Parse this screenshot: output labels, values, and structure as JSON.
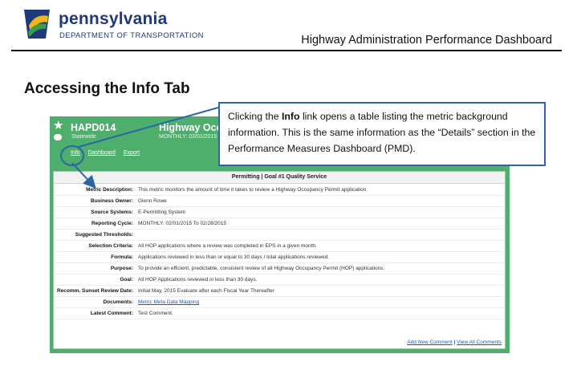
{
  "header": {
    "org_name": "pennsylvania",
    "org_dept": "DEPARTMENT OF TRANSPORTATION",
    "doc_title": "Highway Administration Performance Dashboard"
  },
  "section_title": "Accessing the Info Tab",
  "app": {
    "metric_id": "HAPD014",
    "scope": "Statewide",
    "title": "Highway Occup",
    "period": "MONTHLY: 02/01/2015",
    "tabs": [
      "Info",
      "Dashboard",
      "Export"
    ]
  },
  "panel": {
    "heading": "Permitting | Goal #1 Quality Service",
    "rows": [
      {
        "label": "Metric Description:",
        "value": "This metric monitors the amount of time it takes to review a Highway Occupancy Permit application."
      },
      {
        "label": "Business Owner:",
        "value": "Glenn Rowe"
      },
      {
        "label": "Source Systems:",
        "value": "E-Permitting System"
      },
      {
        "label": "Reporting Cycle:",
        "value": "MONTHLY: 02/01/2015 To 02/28/2015"
      },
      {
        "label": "Suggested Thresholds:",
        "value": ""
      },
      {
        "label": "Selection Criteria:",
        "value": "All HOP applications where a review was completed in EPS in a given month."
      },
      {
        "label": "Formula:",
        "value": "Applications reviewed in less than or equal to 30 days / total applications reviewed."
      },
      {
        "label": "Purpose:",
        "value": "To provide an efficient, predictable, consistent review of all Highway Occupancy Permit (HOP) applications."
      },
      {
        "label": "Goal:",
        "value": "All HOP Applications reviewed in less than 30 days."
      },
      {
        "label": "Recomm. Sunset Review Date:",
        "value": "Initial May, 2015 Evaluate after each Fiscal Year Thereafter"
      },
      {
        "label": "Documents:",
        "value": "Metric Meta Data Mapping"
      },
      {
        "label": "Latest Comment:",
        "value": "Test Comment."
      }
    ],
    "add_comment": "Add New Comment",
    "separator": "|",
    "view_comments": "View All Comments"
  },
  "callout": {
    "part1": "Clicking the ",
    "bold": "Info",
    "part2": " link opens a table listing the metric background information.  This is the same information as the “Details” section in the Performance Measures Dashboard (PMD)."
  },
  "colors": {
    "brand_blue": "#1f3a7a",
    "app_green": "#4eae6c",
    "callout_border": "#2d66a6",
    "link": "#1f57c2"
  },
  "icons": [
    "keystone-logo-icon",
    "star-icon",
    "comment-icon"
  ]
}
